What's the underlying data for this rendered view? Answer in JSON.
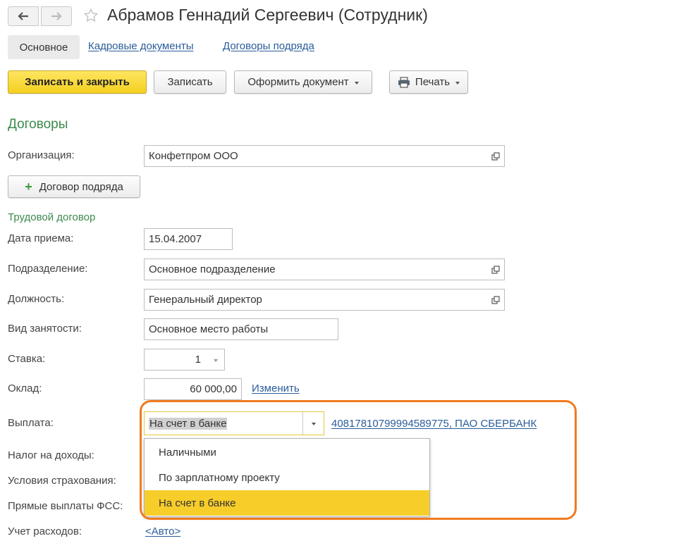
{
  "window": {
    "title": "Абрамов Геннадий Сергеевич (Сотрудник)",
    "back_icon": "arrow-left-icon",
    "forward_icon": "arrow-right-icon",
    "favorite_icon": "star-icon"
  },
  "tabs": [
    {
      "label": "Основное",
      "active": true
    },
    {
      "label": "Кадровые документы",
      "active": false
    },
    {
      "label": "Договоры подряда",
      "active": false
    }
  ],
  "toolbar": {
    "save_close": "Записать и закрыть",
    "save": "Записать",
    "make_document": "Оформить документ",
    "print": "Печать",
    "print_icon": "printer-icon"
  },
  "contracts": {
    "heading": "Договоры",
    "organization_label": "Организация:",
    "organization_value": "Конфетпром ООО",
    "add_contract_button": "Договор подряда",
    "add_icon": "plus-icon"
  },
  "labor": {
    "heading": "Трудовой договор",
    "hire_date_label": "Дата приема:",
    "hire_date_value": "15.04.2007",
    "department_label": "Подразделение:",
    "department_value": "Основное подразделение",
    "position_label": "Должность:",
    "position_value": "Генеральный директор",
    "employment_label": "Вид занятости:",
    "employment_value": "Основное место работы",
    "rate_label": "Ставка:",
    "rate_value": "1",
    "salary_label": "Оклад:",
    "salary_value": "60 000,00",
    "salary_change_link": "Изменить",
    "payment_label": "Выплата:",
    "payment_value": "На счет в банке",
    "payment_account_link": "40817810799994589775, ПАО СБЕРБАНК",
    "payment_options": [
      "Наличными",
      "По зарплатному проекту",
      "На счет в банке"
    ],
    "payment_selected_index": 2,
    "tax_label": "Налог на доходы:",
    "insurance_label": "Условия страхования:",
    "fss_label": "Прямые выплаты ФСС:",
    "expenses_label": "Учет расходов:",
    "expenses_link": "<Авто>"
  },
  "colors": {
    "accent_yellow": "#f5d021",
    "section_green": "#3d8a4e",
    "link_blue": "#2a5c9a",
    "highlight_orange": "#f07a20",
    "selected_item": "#f7cd2a"
  }
}
